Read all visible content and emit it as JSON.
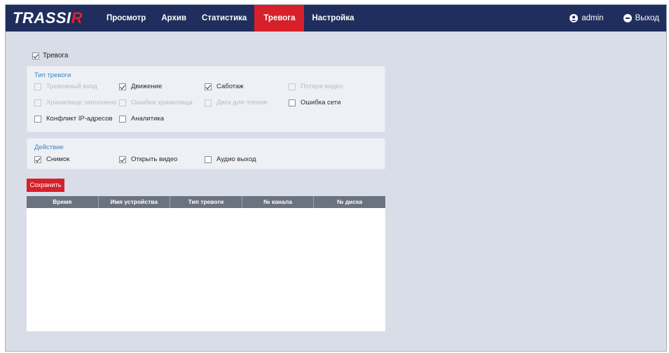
{
  "app": {
    "logo_main": "TRASSI",
    "logo_accent": "R"
  },
  "nav": {
    "items": [
      {
        "label": "Просмотр",
        "active": false
      },
      {
        "label": "Архив",
        "active": false
      },
      {
        "label": "Статистика",
        "active": false
      },
      {
        "label": "Тревога",
        "active": true
      },
      {
        "label": "Настройка",
        "active": false
      }
    ]
  },
  "user": {
    "name": "admin",
    "logout_label": "Выход"
  },
  "alarm_enable": {
    "label": "Тревога",
    "checked": true
  },
  "alarm_types": {
    "title": "Тип тревоги",
    "items": [
      {
        "label": "Тревожный вход",
        "checked": false,
        "disabled": true
      },
      {
        "label": "Движение",
        "checked": true,
        "disabled": false
      },
      {
        "label": "Саботаж",
        "checked": true,
        "disabled": false
      },
      {
        "label": "Потеря видео",
        "checked": false,
        "disabled": true
      },
      {
        "label": "Хранилище заполнено",
        "checked": false,
        "disabled": true
      },
      {
        "label": "Ошибка хранилища",
        "checked": false,
        "disabled": true
      },
      {
        "label": "Диск для чтения",
        "checked": false,
        "disabled": true
      },
      {
        "label": "Ошибка сети",
        "checked": false,
        "disabled": false
      },
      {
        "label": "Конфликт IP-адресов",
        "checked": false,
        "disabled": false
      },
      {
        "label": "Аналитика",
        "checked": false,
        "disabled": false
      }
    ]
  },
  "actions": {
    "title": "Действие",
    "items": [
      {
        "label": "Снимок",
        "checked": true
      },
      {
        "label": "Открыть видео",
        "checked": true
      },
      {
        "label": "Аудио выход",
        "checked": false
      }
    ]
  },
  "save_label": "Сохранить",
  "table": {
    "columns": [
      "Время",
      "Имя устройства",
      "Тип тревоги",
      "№ канала",
      "№ диска"
    ],
    "rows": []
  },
  "colors": {
    "topbar": "#1f2e5c",
    "accent": "#d7202a",
    "link": "#3a84c8",
    "header": "#6b7280"
  }
}
